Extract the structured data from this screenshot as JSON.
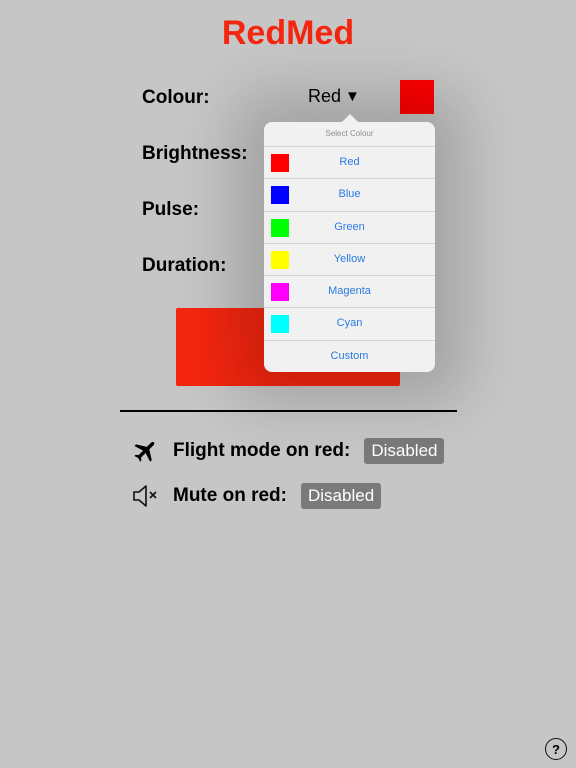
{
  "app": {
    "title": "RedMed",
    "title_color": "#f5260f"
  },
  "settings": {
    "colour_label": "Colour:",
    "colour_value": "Red",
    "colour_caret": "▼",
    "current_colour_hex": "#ff0000",
    "brightness_label": "Brightness:",
    "pulse_label": "Pulse:",
    "duration_label": "Duration:",
    "start_button_color": "#f5260f"
  },
  "toggles": {
    "flight_mode": {
      "label": "Flight mode on red:",
      "value": "Disabled",
      "icon": "airplane-icon"
    },
    "mute": {
      "label": "Mute on red:",
      "value": "Disabled",
      "icon": "speaker-mute-icon"
    }
  },
  "popover": {
    "title": "Select Colour",
    "items": [
      {
        "label": "Red",
        "color": "#ff0000"
      },
      {
        "label": "Blue",
        "color": "#0000ff"
      },
      {
        "label": "Green",
        "color": "#00ff00"
      },
      {
        "label": "Yellow",
        "color": "#ffff00"
      },
      {
        "label": "Magenta",
        "color": "#ff00ff"
      },
      {
        "label": "Cyan",
        "color": "#00ffff"
      },
      {
        "label": "Custom",
        "color": ""
      }
    ]
  },
  "help": {
    "label": "?",
    "icon": "help-icon"
  }
}
